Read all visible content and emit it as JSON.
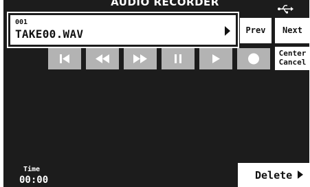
{
  "header": {
    "title": "AUDIO RECORDER",
    "usb_icon": "usb-icon"
  },
  "file": {
    "number": "001",
    "name": "TAKE00.WAV",
    "arrow_icon": "chevron-right-icon"
  },
  "nav": {
    "prev_label": "Prev",
    "next_label": "Next",
    "center_cancel_line1": "Center",
    "center_cancel_line2": "Cancel"
  },
  "transport": [
    {
      "name": "skip-to-start-button",
      "icon": "skip-back-icon"
    },
    {
      "name": "rewind-button",
      "icon": "rewind-icon"
    },
    {
      "name": "fast-forward-button",
      "icon": "fast-forward-icon"
    },
    {
      "name": "pause-button",
      "icon": "pause-icon"
    },
    {
      "name": "play-button",
      "icon": "play-icon"
    },
    {
      "name": "record-button",
      "icon": "record-icon"
    }
  ],
  "time": {
    "label": "Time",
    "value": "00:00"
  },
  "actions": {
    "delete_label": "Delete",
    "delete_icon": "chevron-right-icon"
  },
  "colors": {
    "background": "#1c1c1c",
    "button_gray": "#b3b3b3",
    "button_white": "#ffffff"
  }
}
